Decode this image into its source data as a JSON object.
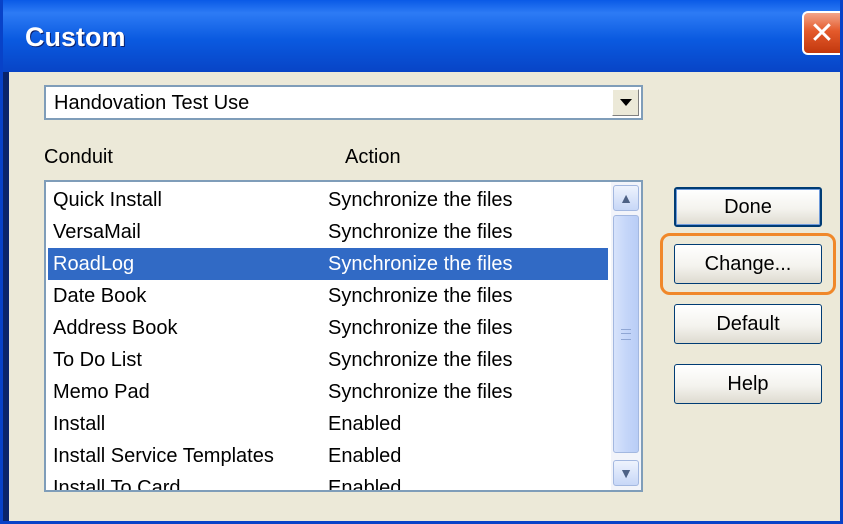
{
  "window": {
    "title": "Custom",
    "close_glyph": "✕"
  },
  "combo": {
    "value": "Handovation Test Use"
  },
  "headers": {
    "conduit": "Conduit",
    "action": "Action"
  },
  "rows": [
    {
      "conduit": "Quick Install",
      "action": "Synchronize the files",
      "selected": false
    },
    {
      "conduit": "VersaMail",
      "action": "Synchronize the files",
      "selected": false
    },
    {
      "conduit": "RoadLog",
      "action": "Synchronize the files",
      "selected": true
    },
    {
      "conduit": "Date Book",
      "action": "Synchronize the files",
      "selected": false
    },
    {
      "conduit": "Address Book",
      "action": "Synchronize the files",
      "selected": false
    },
    {
      "conduit": "To Do List",
      "action": "Synchronize the files",
      "selected": false
    },
    {
      "conduit": "Memo Pad",
      "action": "Synchronize the files",
      "selected": false
    },
    {
      "conduit": "Install",
      "action": "Enabled",
      "selected": false
    },
    {
      "conduit": "Install Service Templates",
      "action": "Enabled",
      "selected": false
    },
    {
      "conduit": "Install To Card",
      "action": "Enabled",
      "selected": false
    }
  ],
  "buttons": {
    "done": "Done",
    "change": "Change...",
    "default": "Default",
    "help": "Help"
  },
  "colors": {
    "selection": "#316ac5",
    "highlight": "#f0882a",
    "titlebar": "#0a5ae0"
  }
}
